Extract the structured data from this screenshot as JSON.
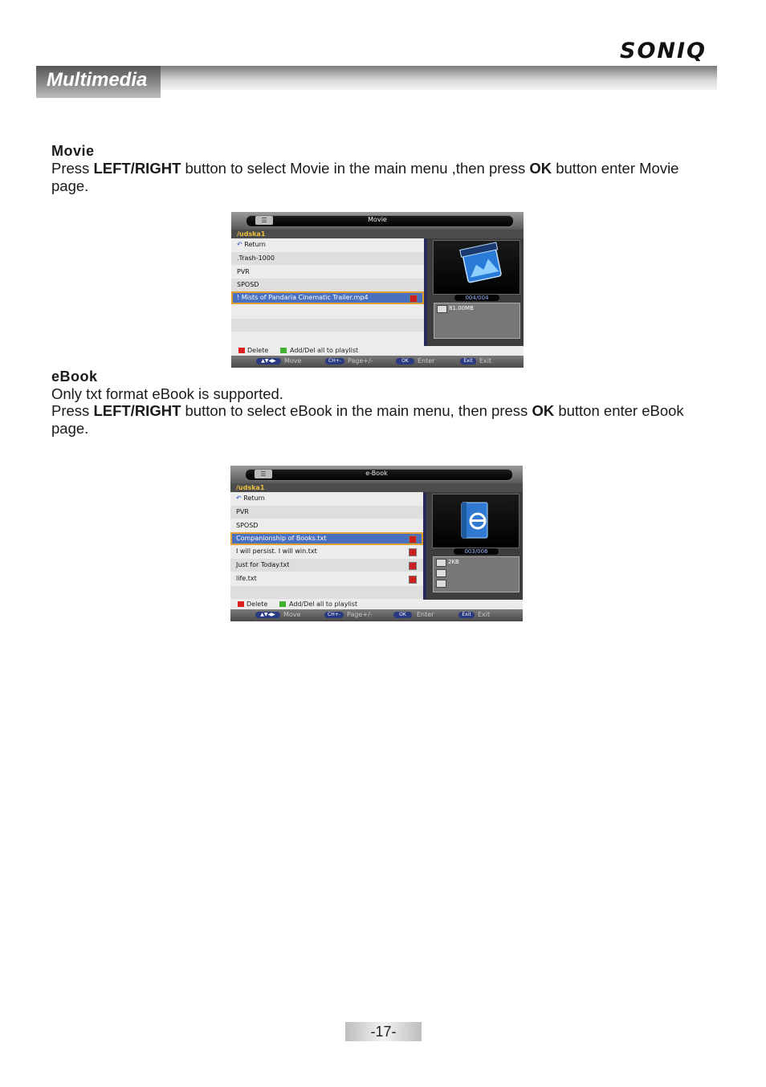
{
  "header": {
    "logo": "SONIQ",
    "section_title": "Multimedia"
  },
  "movie": {
    "heading": "Movie",
    "p1": "Press ",
    "p1_bold1": "LEFT/RIGHT",
    "p1_mid": " button to select Movie in the main menu ,then press ",
    "p1_bold2": "OK",
    "p1_end": " button enter Movie page."
  },
  "ebook": {
    "heading": "eBook",
    "p0": "Only txt format eBook is supported.",
    "p1": "Press ",
    "p1_bold1": "LEFT/RIGHT",
    "p1_mid": " button to select eBook in the main menu, then press ",
    "p1_bold2": "OK",
    "p1_end": " button enter eBook page."
  },
  "movie_screen": {
    "title": "Movie",
    "path": "/udska1",
    "rows": [
      "Return",
      ".Trash-1000",
      "PVR",
      "SPOSD",
      "! Mists of Pandaria Cinematic Trailer.mp4"
    ],
    "counter": "004/004",
    "info": [
      "81.00MB"
    ]
  },
  "ebook_screen": {
    "title": "e-Book",
    "path": "/udska1",
    "rows": [
      "Return",
      "PVR",
      "SPOSD",
      "Companionship of Books.txt",
      "I will persist. I will win.txt",
      "Just for Today.txt",
      "life.txt"
    ],
    "counter": "003/006",
    "info": [
      "2KB"
    ]
  },
  "legend": {
    "delete": "Delete",
    "add": "Add/Del all to playlist"
  },
  "keys": {
    "move_key": "▲▼◀▶",
    "move": "Move",
    "page_key": "CH+-",
    "page": "Page+/-",
    "ok_key": "OK",
    "enter": "Enter",
    "exit_key": "Exit",
    "exit": "Exit"
  },
  "colors": {
    "selected_row": "#4a70c0",
    "highlight_border": "#e2a030",
    "delete": "#dd2020",
    "add": "#40b030",
    "path": "#f0c040"
  },
  "page_number": "-17-"
}
